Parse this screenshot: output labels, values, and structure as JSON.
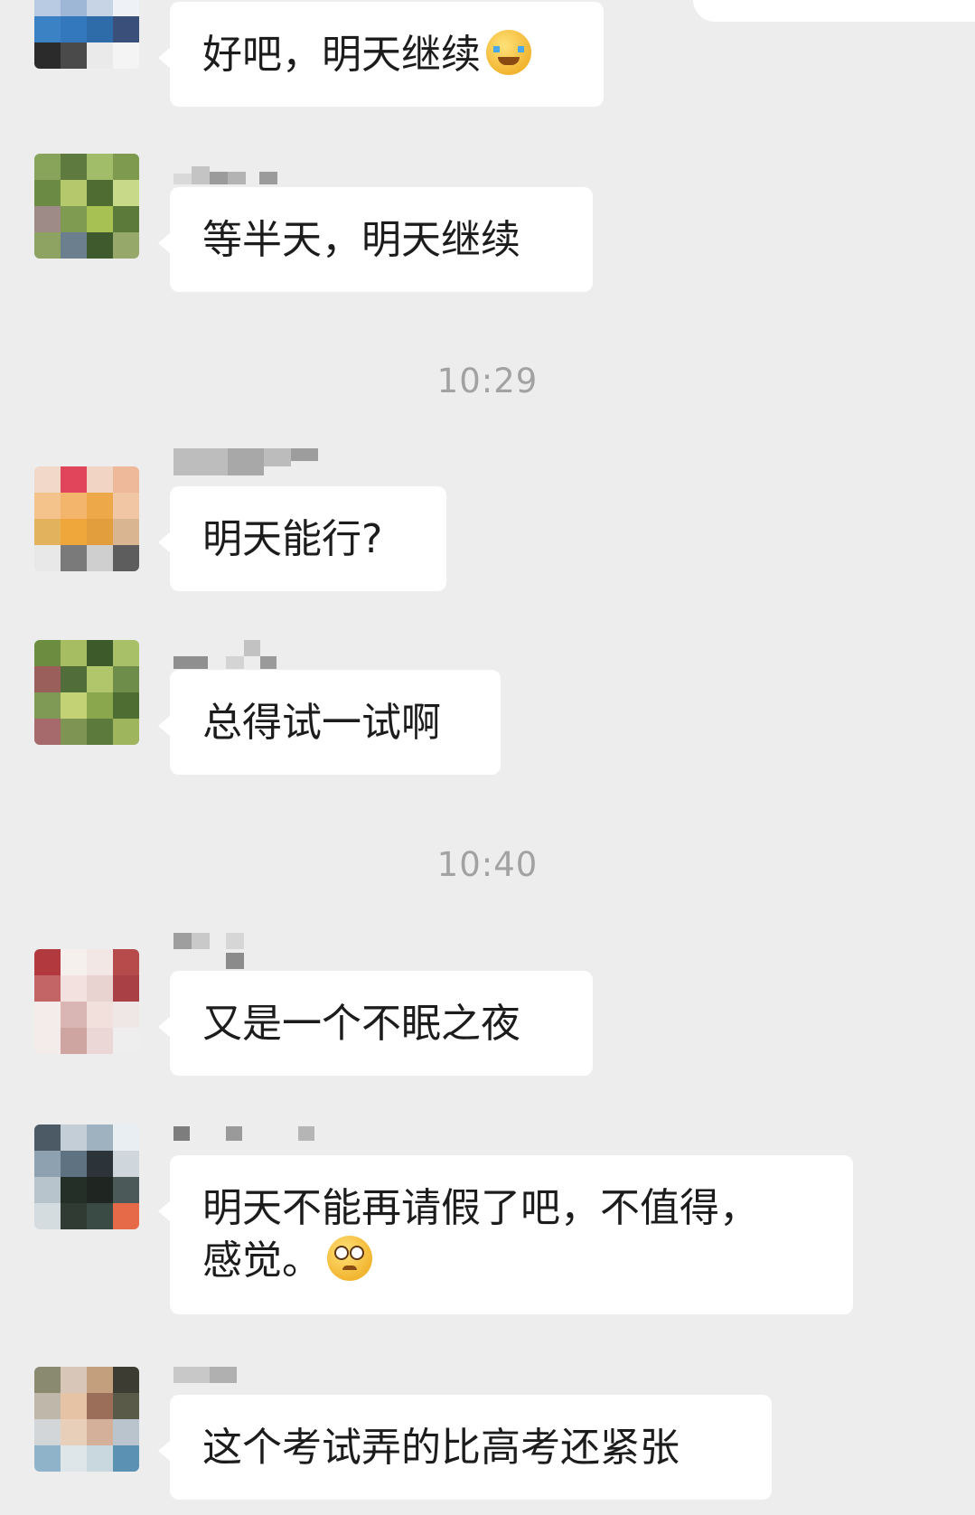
{
  "timestamps": [
    "10:29",
    "10:40"
  ],
  "messages": [
    {
      "text": "好吧，明天继续",
      "emoji": "loudly-crying-face-icon"
    },
    {
      "text": "等半天，明天继续"
    },
    {
      "text": "明天能行?"
    },
    {
      "text": "总得试一试啊"
    },
    {
      "text": "又是一个不眠之夜"
    },
    {
      "line1": "明天不能再请假了吧，不值得，",
      "line2": "感觉。",
      "emoji": "pleading-face-icon"
    },
    {
      "text": "这个考试弄的比高考还紧张"
    }
  ],
  "colors": {
    "background": "#ededed",
    "bubble": "#ffffff",
    "timestamp": "#a2a2a2",
    "text": "#1c1c1c"
  }
}
